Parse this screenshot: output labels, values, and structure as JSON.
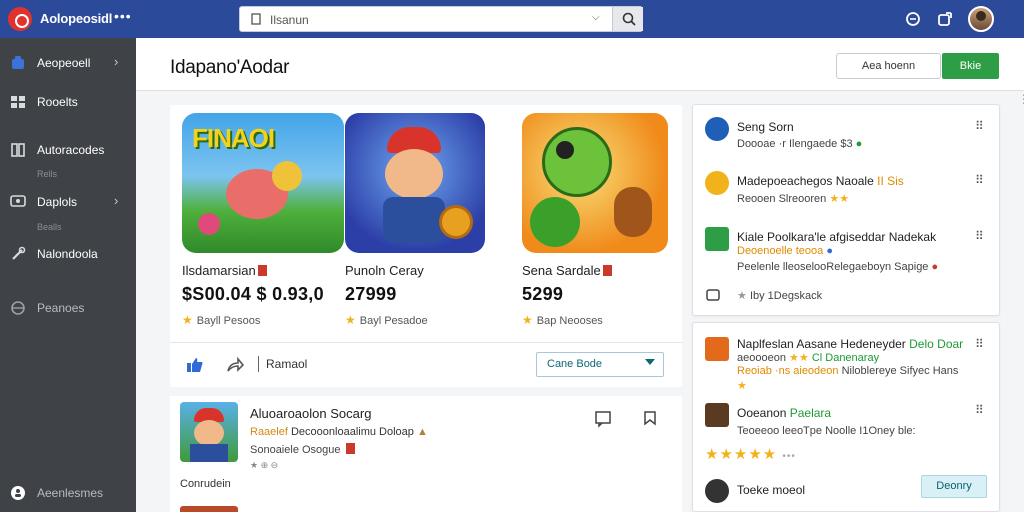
{
  "app": {
    "title": "Aolopeosidl",
    "menu_dots": "•••"
  },
  "search": {
    "value": "Ilsanun"
  },
  "sidebar": {
    "items": [
      {
        "label": "Aeopeoell",
        "icon": "home-icon"
      },
      {
        "label": "Rooelts",
        "icon": "grid-icon"
      },
      {
        "label": "Autoracodes",
        "icon": "book-icon",
        "sub": "Rells"
      },
      {
        "label": "Daplols",
        "icon": "monitor-icon",
        "sub": "Bealls"
      },
      {
        "label": "Nalondoola",
        "icon": "wrench-icon"
      },
      {
        "label": "Peanoes",
        "icon": "globe-icon"
      }
    ],
    "footer": "Aeenlesmes"
  },
  "header": {
    "title": "Idapano'Aodar",
    "outline_button": "Aea hoenn",
    "primary_button": "Bkie"
  },
  "featured": [
    {
      "name": "Ilsdamarsian",
      "price": "$S00.04 $ 0.93,0",
      "rating_text": "Bayll Pesoos",
      "thumb_text": "FINAOI"
    },
    {
      "name": "Punoln Ceray",
      "price": "27999",
      "rating_text": "Bayl Pesadoe"
    },
    {
      "name": "Sena Sardale",
      "price": "5299",
      "rating_text": "Bap Neooses"
    }
  ],
  "action_bar": {
    "label": "Ramaol",
    "select_value": "Cane Bode"
  },
  "list": {
    "title": "Aluoaroaolon Socarg",
    "sub_orange": "Raaelef",
    "sub_rest": "Decooonloaalimu Doloap",
    "sub2": "Sonoaiele Osogue",
    "meta": "★ ⊕ ⊖",
    "footer": "Conrudein"
  },
  "right_top": [
    {
      "title": "Seng Sorn",
      "sub": "Doooae ·r Ilengaede  $3"
    },
    {
      "title": "Madepoeachegos Naoale",
      "title_green": "II Sis",
      "sub": "Reooen Slreooren"
    },
    {
      "title": "Kiale Poolkara'le afgiseddar Nadekak",
      "sub_orange": "Deoenoelle",
      "sub_orange2": "teooa",
      "sub2": "Peelenle lleoselooRelegaeboyn Sapige"
    },
    {
      "title": "Iby 1Degskack"
    }
  ],
  "right_bottom": [
    {
      "title": "Naplfeslan Aasane Hedeneyder",
      "title_green": "Delo Doar",
      "sub": "aeoooeon",
      "sub_green": "Cl Danenaray",
      "sub2": "Reoiab ·ns aieodeon",
      "sub2_rest": "Niloblereye Sifyec Hans"
    },
    {
      "title": "Ooeanon",
      "title_green": "Paelara",
      "sub": "Teoeeoo leeoTpe Noolle I1Oney ble:"
    },
    {
      "title": "Toeke moeol",
      "button": "Deonry"
    }
  ],
  "colors": {
    "topbar": "#2b4a9a",
    "sidebar": "#3f4247",
    "primary": "#2e9e46",
    "accent_star": "#f2b21a"
  }
}
